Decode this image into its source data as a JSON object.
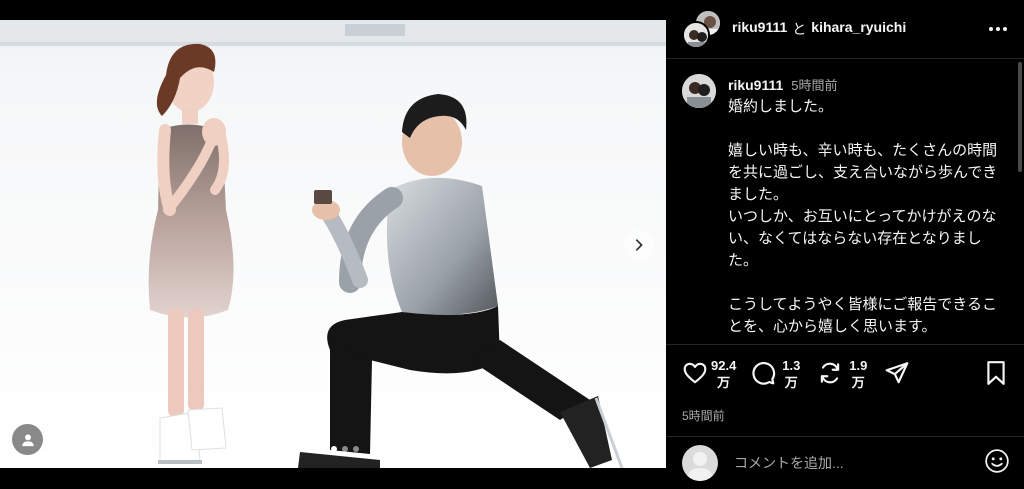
{
  "header": {
    "user1": "riku9111",
    "separator": "と",
    "user2": "kihara_ryuichi",
    "more_icon": "more-horizontal-icon"
  },
  "post": {
    "username": "riku9111",
    "time": "5時間前",
    "caption": "婚約しました。\n\n嬉しい時も、辛い時も、たくさんの時間を共に過ごし、支え合いながら歩んできました。\nいつしか、お互いにとってかけがえのない、なくてはならない存在となりました。\n\nこうしてようやく皆様にご報告できることを、心から嬉しく思います。\n\nこれからも支え合いながら、変わらず"
  },
  "media": {
    "carousel_next_icon": "chevron-right-icon",
    "user_tag_icon": "user-icon",
    "dots": 3,
    "active_dot": 0
  },
  "actions": {
    "likes": "92.4\n万",
    "comments": "1.3\n万",
    "reposts": "1.9\n万",
    "like_icon": "heart-icon",
    "comment_icon": "comment-icon",
    "repost_icon": "repost-icon",
    "share_icon": "send-icon",
    "save_icon": "bookmark-icon",
    "timestamp": "5時間前"
  },
  "comment_box": {
    "placeholder": "コメントを追加...",
    "emoji_icon": "smiley-icon"
  },
  "colors": {
    "background": "#000000",
    "text": "#f5f5f5",
    "secondary_text": "#a8a8a8",
    "divider": "#262626"
  }
}
